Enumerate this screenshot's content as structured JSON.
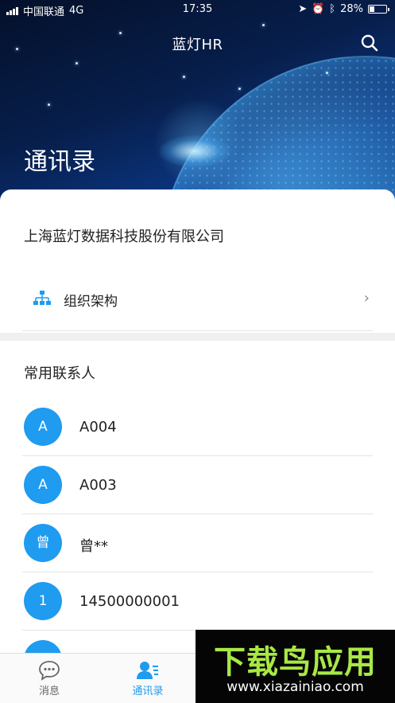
{
  "status_bar": {
    "carrier": "中国联通",
    "network": "4G",
    "time": "17:35",
    "battery": "28%",
    "battery_level": 0.28
  },
  "header": {
    "app_title": "蓝灯HR",
    "page_title": "通讯录"
  },
  "company": {
    "name": "上海蓝灯数据科技股份有限公司",
    "org_label": "组织架构"
  },
  "contacts_section": {
    "title": "常用联系人",
    "items": [
      {
        "avatar": "A",
        "name": "A004"
      },
      {
        "avatar": "A",
        "name": "A003"
      },
      {
        "avatar": "曾",
        "name": "曾**"
      },
      {
        "avatar": "1",
        "name": "14500000001"
      }
    ]
  },
  "tabbar": {
    "tabs": [
      {
        "label": "消息",
        "icon": "chat-bubble-icon",
        "active": false
      },
      {
        "label": "通讯录",
        "icon": "contacts-icon",
        "active": true
      }
    ]
  },
  "watermark": {
    "main": "下载鸟应用",
    "sub": "www.xiazainiao.com"
  },
  "colors": {
    "accent": "#1f9bf0",
    "watermark_green": "#a8e845"
  }
}
